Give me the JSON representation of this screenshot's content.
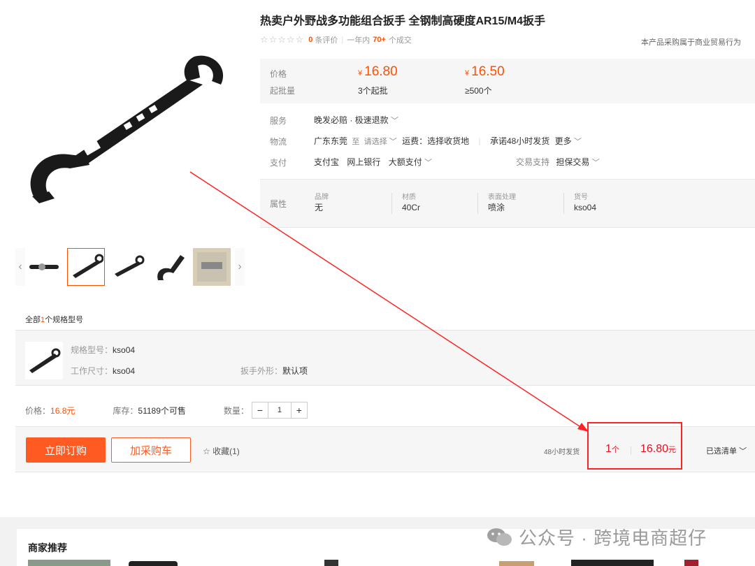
{
  "product": {
    "title": "热卖户外野战多功能组合扳手 全钢制高硬度AR15/M4扳手",
    "reviews_count": "0",
    "reviews_label": "条评价",
    "sales_prefix": "一年内",
    "sales_count": "70+",
    "sales_suffix": "个成交",
    "trade_note": "本产品采购属于商业贸易行为"
  },
  "pricing": {
    "price_label": "价格",
    "moq_label": "起批量",
    "currency": "¥",
    "tiers": [
      {
        "price": "16.80",
        "moq": "3个起批"
      },
      {
        "price": "16.50",
        "moq": "≥500个"
      }
    ]
  },
  "service": {
    "label": "服务",
    "value": "晚发必赔 · 极速退款"
  },
  "logistics": {
    "label": "物流",
    "origin": "广东东莞",
    "to": "至",
    "select": "请选择",
    "freight": "运费：选择收货地",
    "promise": "承诺48小时发货",
    "more": "更多"
  },
  "payment": {
    "label": "支付",
    "methods": [
      "支付宝",
      "网上银行",
      "大额支付"
    ],
    "support_label": "交易支持",
    "support_value": "担保交易"
  },
  "attributes": {
    "label": "属性",
    "items": [
      {
        "key": "品牌",
        "value": "无"
      },
      {
        "key": "材质",
        "value": "40Cr"
      },
      {
        "key": "表面处理",
        "value": "喷涂"
      },
      {
        "key": "货号",
        "value": "kso04"
      }
    ]
  },
  "spec": {
    "count_prefix": "全部",
    "count": "1",
    "count_suffix": "个规格型号",
    "model_label": "规格型号：",
    "model_value": "kso04",
    "size_label": "工作尺寸：",
    "size_value": "kso04",
    "shape_label": "扳手外形：",
    "shape_value": "默认项"
  },
  "stock": {
    "price_label": "价格：",
    "price_value": "16.8元",
    "stock_label": "库存：",
    "stock_value": "51189个可售",
    "qty_label": "数量：",
    "qty_value": "1"
  },
  "buy_bar": {
    "buy_now": "立即订购",
    "add_cart": "加采购车",
    "favorite": "收藏(1)",
    "ship_note": "48小时发货",
    "total_qty": "1",
    "qty_unit": "个",
    "total_price": "16.80",
    "price_unit": "元",
    "selected_list": "已选清单"
  },
  "recommend": {
    "title": "商家推荐"
  },
  "watermark": "公众号 · 跨境电商超仔",
  "colors": {
    "accent": "#ff5000",
    "highlight": "#ff2222",
    "total_red": "#e4101f"
  }
}
